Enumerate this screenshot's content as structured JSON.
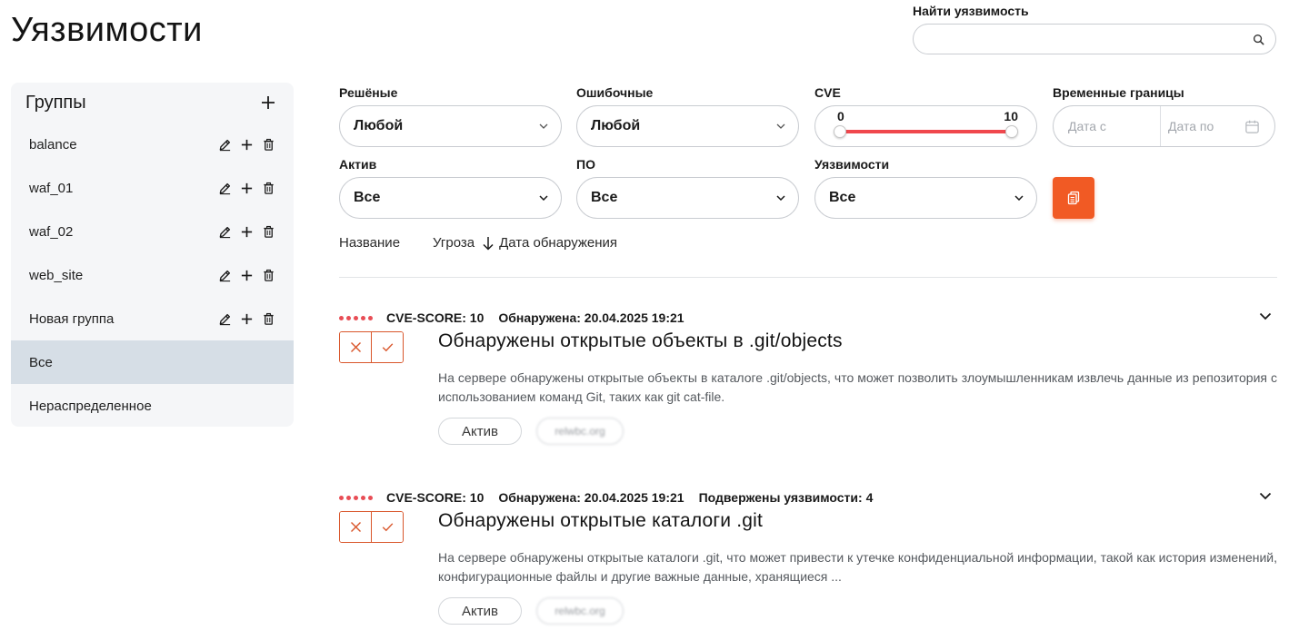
{
  "page": {
    "title": "Уязвимости"
  },
  "search": {
    "label": "Найти уязвимость",
    "value": "",
    "placeholder": ""
  },
  "sidebar": {
    "title": "Группы",
    "groups": [
      {
        "label": "balance",
        "editable": true
      },
      {
        "label": "waf_01",
        "editable": true
      },
      {
        "label": "waf_02",
        "editable": true
      },
      {
        "label": "web_site",
        "editable": true
      },
      {
        "label": "Новая группа",
        "editable": true
      },
      {
        "label": "Все",
        "editable": false,
        "active": true
      },
      {
        "label": "Нераспределенное",
        "editable": false
      }
    ]
  },
  "filters": {
    "resolved": {
      "label": "Решёные",
      "value": "Любой"
    },
    "erroneous": {
      "label": "Ошибочные",
      "value": "Любой"
    },
    "cve": {
      "label": "CVE",
      "min": "0",
      "max": "10"
    },
    "time": {
      "label": "Временные границы",
      "from_placeholder": "Дата с",
      "to_placeholder": "Дата по"
    },
    "asset": {
      "label": "Актив",
      "value": "Все"
    },
    "software": {
      "label": "ПО",
      "value": "Все"
    },
    "vulnerabilities": {
      "label": "Уязвимости",
      "value": "Все"
    }
  },
  "sort": {
    "name": "Название",
    "threat": "Угроза",
    "date": "Дата обнаружения"
  },
  "vulns": [
    {
      "score": "CVE-SCORE: 10",
      "detected": "Обнаружена: 20.04.2025 19:21",
      "affected": "",
      "title": "Обнаружены открытые объекты в .git/objects",
      "description": "На сервере обнаружены открытые объекты в каталоге .git/objects, что может позволить злоумышленникам извлечь данные из репозитория с использованием команд Git, таких как git cat-file.",
      "tag_asset": "Актив",
      "tag_host": "relwbc.org"
    },
    {
      "score": "CVE-SCORE: 10",
      "detected": "Обнаружена: 20.04.2025 19:21",
      "affected": "Подвержены уязвимости: 4",
      "title": "Обнаружены открытые каталоги .git",
      "description": "На сервере обнаружены открытые каталоги .git, что может привести к утечке конфиденциальной информации, такой как история изменений, конфигурационные файлы и другие важные данные, хранящиеся ...",
      "tag_asset": "Актив",
      "tag_host": "relwbc.org"
    }
  ],
  "colors": {
    "accent": "#f15a24",
    "danger": "#e84d55",
    "active_group": "#d6dee6"
  },
  "icons": {
    "search": "search-icon",
    "edit": "edit-icon",
    "add": "plus-icon",
    "delete": "trash-icon",
    "chevron": "chevron-down-icon",
    "calendar": "calendar-icon",
    "export": "export-icon",
    "reject": "close-icon",
    "accept": "check-icon",
    "sort": "arrow-down-icon"
  }
}
